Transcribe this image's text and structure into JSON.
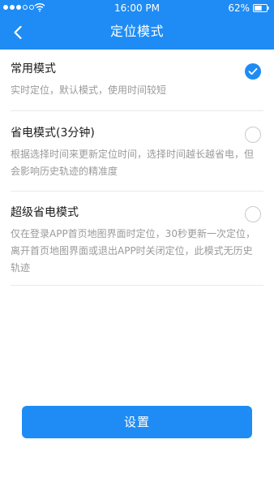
{
  "status_bar": {
    "time": "16:00  PM",
    "battery_percent": "62%",
    "battery_level": 0.62,
    "signal_bars_filled": 3,
    "signal_bars_total": 5
  },
  "nav": {
    "title": "定位模式",
    "back_icon": "chevron-left-icon"
  },
  "modes": [
    {
      "title": "常用模式",
      "description": "实时定位，默认模式，使用时间较短",
      "selected": true
    },
    {
      "title": "省电模式(3分钟)",
      "description": "根据选择时间来更新定位时间，选择时间越长越省电，但会影响历史轨迹的精准度",
      "selected": false
    },
    {
      "title": "超级省电模式",
      "description": "仅在登录APP首页地图界面时定位，30秒更新一次定位，离开首页地图界面或退出APP时关闭定位，此模式无历史轨迹",
      "selected": false
    }
  ],
  "actions": {
    "settings_label": "设置"
  },
  "colors": {
    "accent": "#1e8cf4",
    "text_primary": "#1a1a1a",
    "text_secondary": "#9a9a9a",
    "divider": "#e9e9e9"
  }
}
